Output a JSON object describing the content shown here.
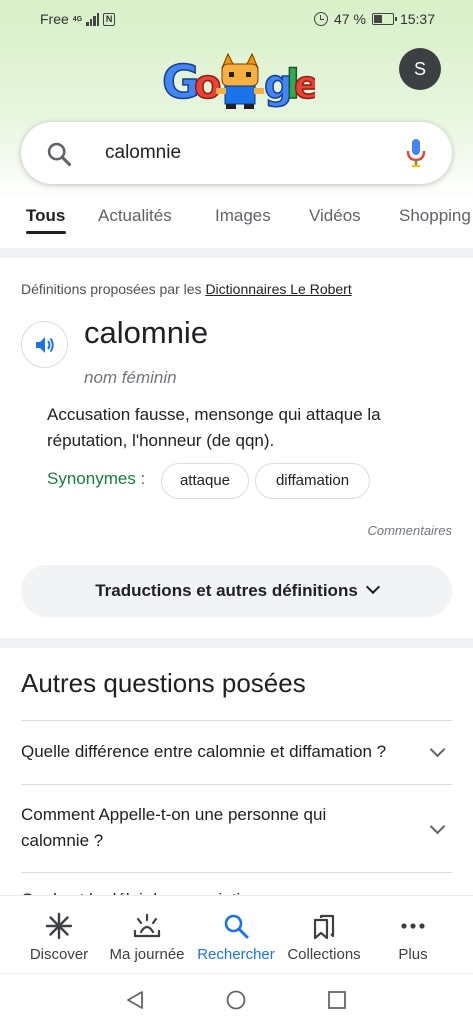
{
  "status_bar": {
    "carrier": "Free",
    "network": "4G",
    "battery": "47 %",
    "battery_level": 0.47,
    "time": "15:37"
  },
  "header": {
    "avatar_initial": "S",
    "doodle": "google-doodle-logo"
  },
  "search": {
    "query": "calomnie"
  },
  "tabs": [
    {
      "label": "Tous",
      "active": true
    },
    {
      "label": "Actualités"
    },
    {
      "label": "Images"
    },
    {
      "label": "Vidéos"
    },
    {
      "label": "Shopping"
    }
  ],
  "dictionary": {
    "provider_prefix": "Définitions proposées par les ",
    "provider_link": "Dictionnaires Le Robert",
    "word": "calomnie",
    "part_of_speech": "nom féminin",
    "definition": "Accusation fausse, mensonge qui attaque la réputation, l'honneur (de qqn).",
    "synonyms_label": "Synonymes :",
    "synonyms": [
      "attaque",
      "diffamation"
    ],
    "feedback": "Commentaires",
    "more_button": "Traductions et autres définitions"
  },
  "paa": {
    "title": "Autres questions posées",
    "questions": [
      "Quelle différence entre calomnie et diffamation ?",
      "Comment Appelle-t-on une personne qui calomnie ?",
      "Quel est le délai de prescription..."
    ]
  },
  "bottom_nav": [
    {
      "label": "Discover",
      "icon": "asterisk-icon"
    },
    {
      "label": "Ma journée",
      "icon": "sunrise-icon"
    },
    {
      "label": "Rechercher",
      "icon": "search-icon",
      "active": true
    },
    {
      "label": "Collections",
      "icon": "bookmarks-icon"
    },
    {
      "label": "Plus",
      "icon": "more-dots-icon"
    }
  ],
  "colors": {
    "accent": "#1a73e8",
    "synonym_green": "#188038",
    "header_green": "#d8f0c8"
  }
}
